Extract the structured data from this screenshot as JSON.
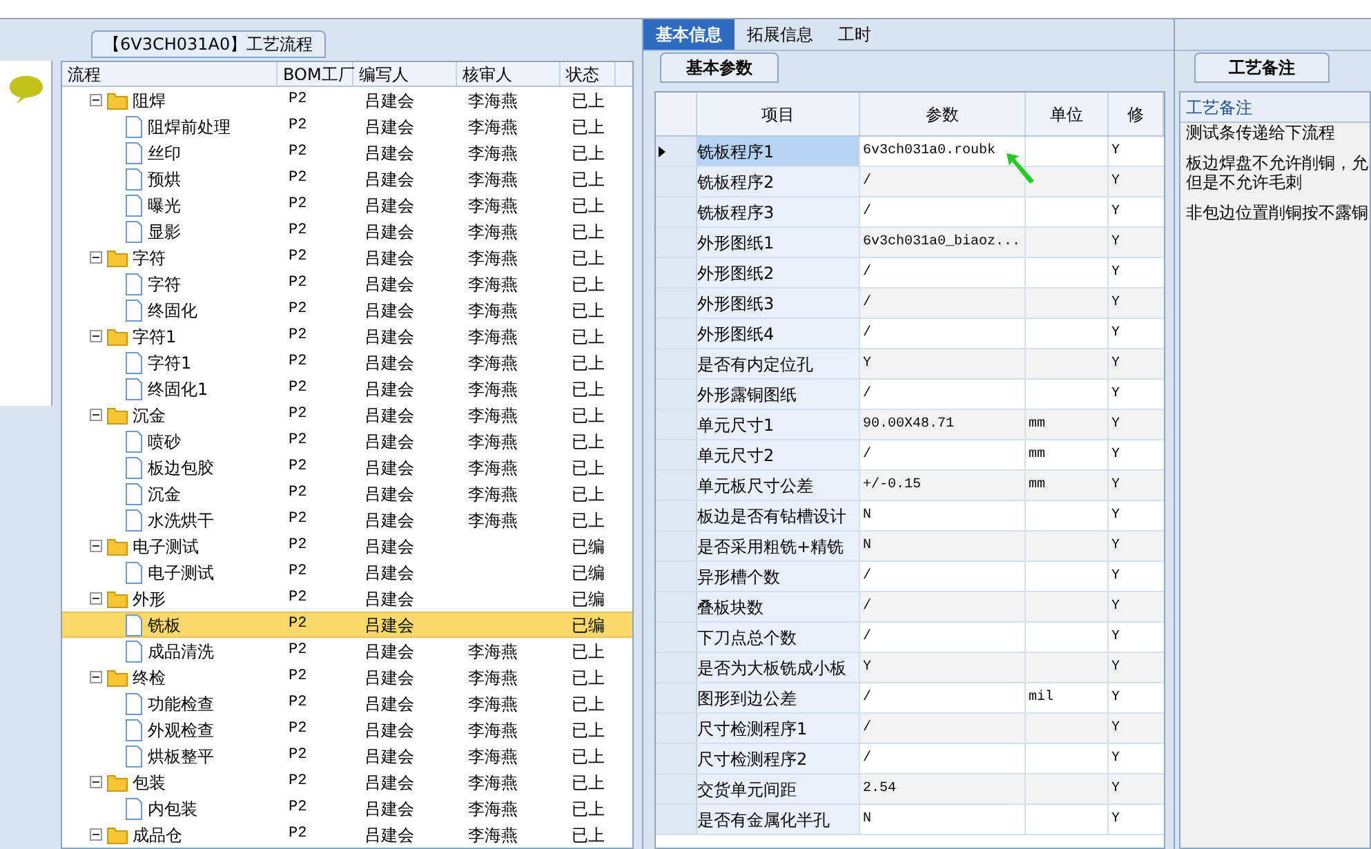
{
  "flow_panel": {
    "title": "【6V3CH031A0】工艺流程",
    "columns": [
      "流程",
      "BOM工厂",
      "编写人",
      "核审人",
      "状态"
    ],
    "tree": [
      {
        "kind": "folder",
        "name": "阻焊",
        "factory": "P2",
        "writer": "吕建会",
        "reviewer": "李海燕",
        "status": "已上",
        "expanded": true,
        "selected": false,
        "children": [
          {
            "kind": "step",
            "name": "阻焊前处理",
            "factory": "P2",
            "writer": "吕建会",
            "reviewer": "李海燕",
            "status": "已上",
            "selected": false
          },
          {
            "kind": "step",
            "name": "丝印",
            "factory": "P2",
            "writer": "吕建会",
            "reviewer": "李海燕",
            "status": "已上",
            "selected": false
          },
          {
            "kind": "step",
            "name": "预烘",
            "factory": "P2",
            "writer": "吕建会",
            "reviewer": "李海燕",
            "status": "已上",
            "selected": false
          },
          {
            "kind": "step",
            "name": "曝光",
            "factory": "P2",
            "writer": "吕建会",
            "reviewer": "李海燕",
            "status": "已上",
            "selected": false
          },
          {
            "kind": "step",
            "name": "显影",
            "factory": "P2",
            "writer": "吕建会",
            "reviewer": "李海燕",
            "status": "已上",
            "selected": false
          }
        ]
      },
      {
        "kind": "folder",
        "name": "字符",
        "factory": "P2",
        "writer": "吕建会",
        "reviewer": "李海燕",
        "status": "已上",
        "expanded": true,
        "selected": false,
        "children": [
          {
            "kind": "step",
            "name": "字符",
            "factory": "P2",
            "writer": "吕建会",
            "reviewer": "李海燕",
            "status": "已上",
            "selected": false
          },
          {
            "kind": "step",
            "name": "终固化",
            "factory": "P2",
            "writer": "吕建会",
            "reviewer": "李海燕",
            "status": "已上",
            "selected": false
          }
        ]
      },
      {
        "kind": "folder",
        "name": "字符1",
        "factory": "P2",
        "writer": "吕建会",
        "reviewer": "李海燕",
        "status": "已上",
        "expanded": true,
        "selected": false,
        "children": [
          {
            "kind": "step",
            "name": "字符1",
            "factory": "P2",
            "writer": "吕建会",
            "reviewer": "李海燕",
            "status": "已上",
            "selected": false
          },
          {
            "kind": "step",
            "name": "终固化1",
            "factory": "P2",
            "writer": "吕建会",
            "reviewer": "李海燕",
            "status": "已上",
            "selected": false
          }
        ]
      },
      {
        "kind": "folder",
        "name": "沉金",
        "factory": "P2",
        "writer": "吕建会",
        "reviewer": "李海燕",
        "status": "已上",
        "expanded": true,
        "selected": false,
        "children": [
          {
            "kind": "step",
            "name": "喷砂",
            "factory": "P2",
            "writer": "吕建会",
            "reviewer": "李海燕",
            "status": "已上",
            "selected": false
          },
          {
            "kind": "step",
            "name": "板边包胶",
            "factory": "P2",
            "writer": "吕建会",
            "reviewer": "李海燕",
            "status": "已上",
            "selected": false
          },
          {
            "kind": "step",
            "name": "沉金",
            "factory": "P2",
            "writer": "吕建会",
            "reviewer": "李海燕",
            "status": "已上",
            "selected": false
          },
          {
            "kind": "step",
            "name": "水洗烘干",
            "factory": "P2",
            "writer": "吕建会",
            "reviewer": "李海燕",
            "status": "已上",
            "selected": false
          }
        ]
      },
      {
        "kind": "folder",
        "name": "电子测试",
        "factory": "P2",
        "writer": "吕建会",
        "status": "已编",
        "expanded": true,
        "selected": false,
        "children": [
          {
            "kind": "step",
            "name": "电子测试",
            "factory": "P2",
            "writer": "吕建会",
            "status": "已编",
            "selected": false
          }
        ]
      },
      {
        "kind": "folder",
        "name": "外形",
        "factory": "P2",
        "writer": "吕建会",
        "status": "已编",
        "expanded": true,
        "selected": false,
        "children": [
          {
            "kind": "step",
            "name": "铣板",
            "factory": "P2",
            "writer": "吕建会",
            "status": "已编",
            "selected": true
          },
          {
            "kind": "step",
            "name": "成品清洗",
            "factory": "P2",
            "writer": "吕建会",
            "reviewer": "李海燕",
            "status": "已上",
            "selected": false
          }
        ]
      },
      {
        "kind": "folder",
        "name": "终检",
        "factory": "P2",
        "writer": "吕建会",
        "reviewer": "李海燕",
        "status": "已上",
        "expanded": true,
        "selected": false,
        "children": [
          {
            "kind": "step",
            "name": "功能检查",
            "factory": "P2",
            "writer": "吕建会",
            "reviewer": "李海燕",
            "status": "已上",
            "selected": false
          },
          {
            "kind": "step",
            "name": "外观检查",
            "factory": "P2",
            "writer": "吕建会",
            "reviewer": "李海燕",
            "status": "已上",
            "selected": false
          },
          {
            "kind": "step",
            "name": "烘板整平",
            "factory": "P2",
            "writer": "吕建会",
            "reviewer": "李海燕",
            "status": "已上",
            "selected": false
          }
        ]
      },
      {
        "kind": "folder",
        "name": "包装",
        "factory": "P2",
        "writer": "吕建会",
        "reviewer": "李海燕",
        "status": "已上",
        "expanded": true,
        "selected": false,
        "children": [
          {
            "kind": "step",
            "name": "内包装",
            "factory": "P2",
            "writer": "吕建会",
            "reviewer": "李海燕",
            "status": "已上",
            "selected": false
          }
        ]
      },
      {
        "kind": "folder",
        "name": "成品仓",
        "factory": "P2",
        "writer": "吕建会",
        "reviewer": "李海燕",
        "status": "已上",
        "expanded": true,
        "selected": false
      }
    ]
  },
  "tabs": [
    {
      "label": "基本信息",
      "selected": true
    },
    {
      "label": "拓展信息",
      "selected": false
    },
    {
      "label": "工时",
      "selected": false
    }
  ],
  "params_panel": {
    "tab": "基本参数",
    "columns": [
      "项目",
      "参数",
      "单位",
      "修"
    ],
    "rows": [
      {
        "item": "铣板程序1",
        "value": "6v3ch031a0.roubk",
        "modified": "Y",
        "selected": true
      },
      {
        "item": "铣板程序2",
        "value": "/",
        "modified": "Y",
        "selected": false
      },
      {
        "item": "铣板程序3",
        "value": "/",
        "modified": "Y",
        "selected": false
      },
      {
        "item": "外形图纸1",
        "value": "6v3ch031a0_biaoz...",
        "modified": "Y",
        "selected": false
      },
      {
        "item": "外形图纸2",
        "value": "/",
        "modified": "Y",
        "selected": false
      },
      {
        "item": "外形图纸3",
        "value": "/",
        "modified": "Y",
        "selected": false
      },
      {
        "item": "外形图纸4",
        "value": "/",
        "modified": "Y",
        "selected": false
      },
      {
        "item": "是否有内定位孔",
        "value": "Y",
        "modified": "Y",
        "selected": false
      },
      {
        "item": "外形露铜图纸",
        "value": "/",
        "modified": "Y",
        "selected": false
      },
      {
        "item": "单元尺寸1",
        "value": "90.00X48.71",
        "unit": "mm",
        "modified": "Y",
        "selected": false
      },
      {
        "item": "单元尺寸2",
        "value": "/",
        "unit": "mm",
        "modified": "Y",
        "selected": false
      },
      {
        "item": "单元板尺寸公差",
        "value": "+/-0.15",
        "unit": "mm",
        "modified": "Y",
        "selected": false
      },
      {
        "item": "板边是否有钻槽设计",
        "value": "N",
        "modified": "Y",
        "selected": false
      },
      {
        "item": "是否采用粗铣+精铣",
        "value": "N",
        "modified": "Y",
        "selected": false
      },
      {
        "item": "异形槽个数",
        "value": "/",
        "modified": "Y",
        "selected": false
      },
      {
        "item": "叠板块数",
        "value": "/",
        "modified": "Y",
        "selected": false
      },
      {
        "item": "下刀点总个数",
        "value": "/",
        "modified": "Y",
        "selected": false
      },
      {
        "item": "是否为大板铣成小板",
        "value": "Y",
        "modified": "Y",
        "selected": false
      },
      {
        "item": "图形到边公差",
        "value": "/",
        "unit": "mil",
        "modified": "Y",
        "selected": false
      },
      {
        "item": "尺寸检测程序1",
        "value": "/",
        "modified": "Y",
        "selected": false
      },
      {
        "item": "尺寸检测程序2",
        "value": "/",
        "modified": "Y",
        "selected": false
      },
      {
        "item": "交货单元间距",
        "value": "2.54",
        "modified": "Y",
        "selected": false
      },
      {
        "item": "是否有金属化半孔",
        "value": "N",
        "modified": "Y",
        "selected": false
      }
    ]
  },
  "notes_panel": {
    "tab": "工艺备注",
    "heading": "工艺备注",
    "lines": [
      "测试条传递给下流程",
      "板边焊盘不允许削铜，允",
      "但是不允许毛刺",
      "非包边位置削铜按不露铜"
    ]
  }
}
